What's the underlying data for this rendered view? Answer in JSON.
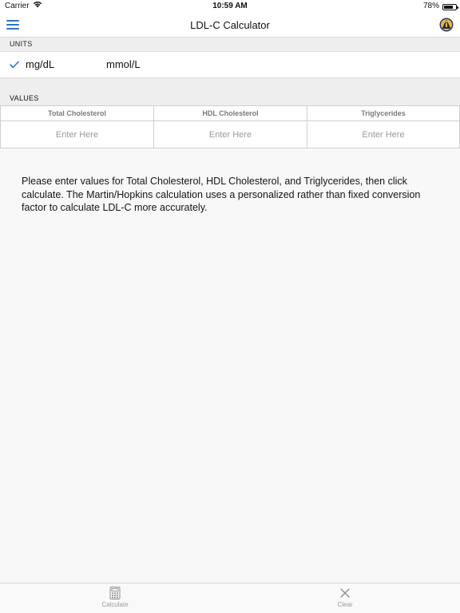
{
  "status_bar": {
    "carrier": "Carrier",
    "time": "10:59 AM",
    "battery_percent": "78%",
    "battery_level": 0.78
  },
  "nav": {
    "title": "LDL-C Calculator",
    "menu_icon": "menu-icon",
    "logo_icon": "app-logo-icon",
    "accent_color": "#2e73c4"
  },
  "units": {
    "header": "UNITS",
    "options": [
      {
        "label": "mg/dL",
        "selected": true
      },
      {
        "label": "mmol/L",
        "selected": false
      }
    ]
  },
  "values": {
    "header": "VALUES",
    "columns": [
      {
        "label": "Total Cholesterol",
        "placeholder": "Enter Here",
        "value": ""
      },
      {
        "label": "HDL Cholesterol",
        "placeholder": "Enter Here",
        "value": ""
      },
      {
        "label": "Triglycerides",
        "placeholder": "Enter Here",
        "value": ""
      }
    ]
  },
  "info": {
    "text": "Please enter values for Total Cholesterol, HDL Cholesterol, and Triglycerides, then click calculate. The Martin/Hopkins calculation uses a personalized rather than fixed conversion factor to calculate LDL-C more accurately."
  },
  "tab_bar": {
    "items": [
      {
        "label": "Calculate",
        "icon": "calculator-icon"
      },
      {
        "label": "Clear",
        "icon": "close-icon"
      }
    ]
  }
}
